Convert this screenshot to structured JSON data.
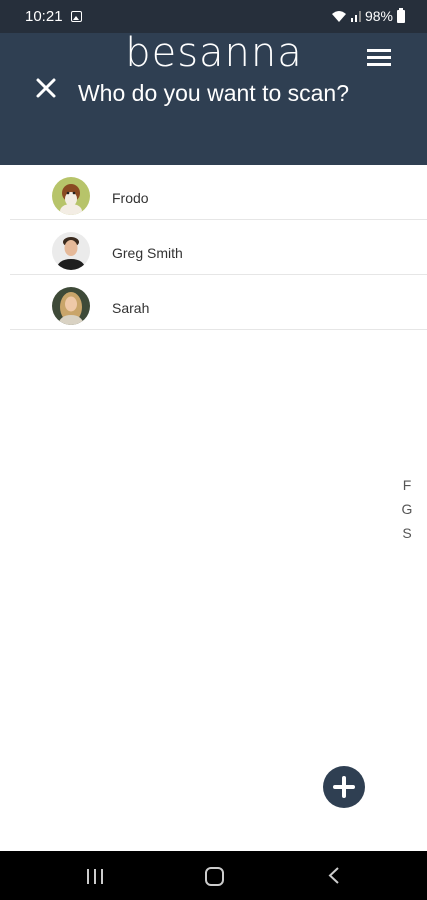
{
  "status": {
    "time": "10:21",
    "battery": "98%"
  },
  "header": {
    "brand": "besanna",
    "title": "Who do you want to scan?"
  },
  "people": [
    {
      "name": "Frodo"
    },
    {
      "name": "Greg Smith"
    },
    {
      "name": "Sarah"
    }
  ],
  "index_letters": [
    "F",
    "G",
    "S"
  ],
  "colors": {
    "header": "#2f3f52",
    "status": "#262f3b"
  }
}
